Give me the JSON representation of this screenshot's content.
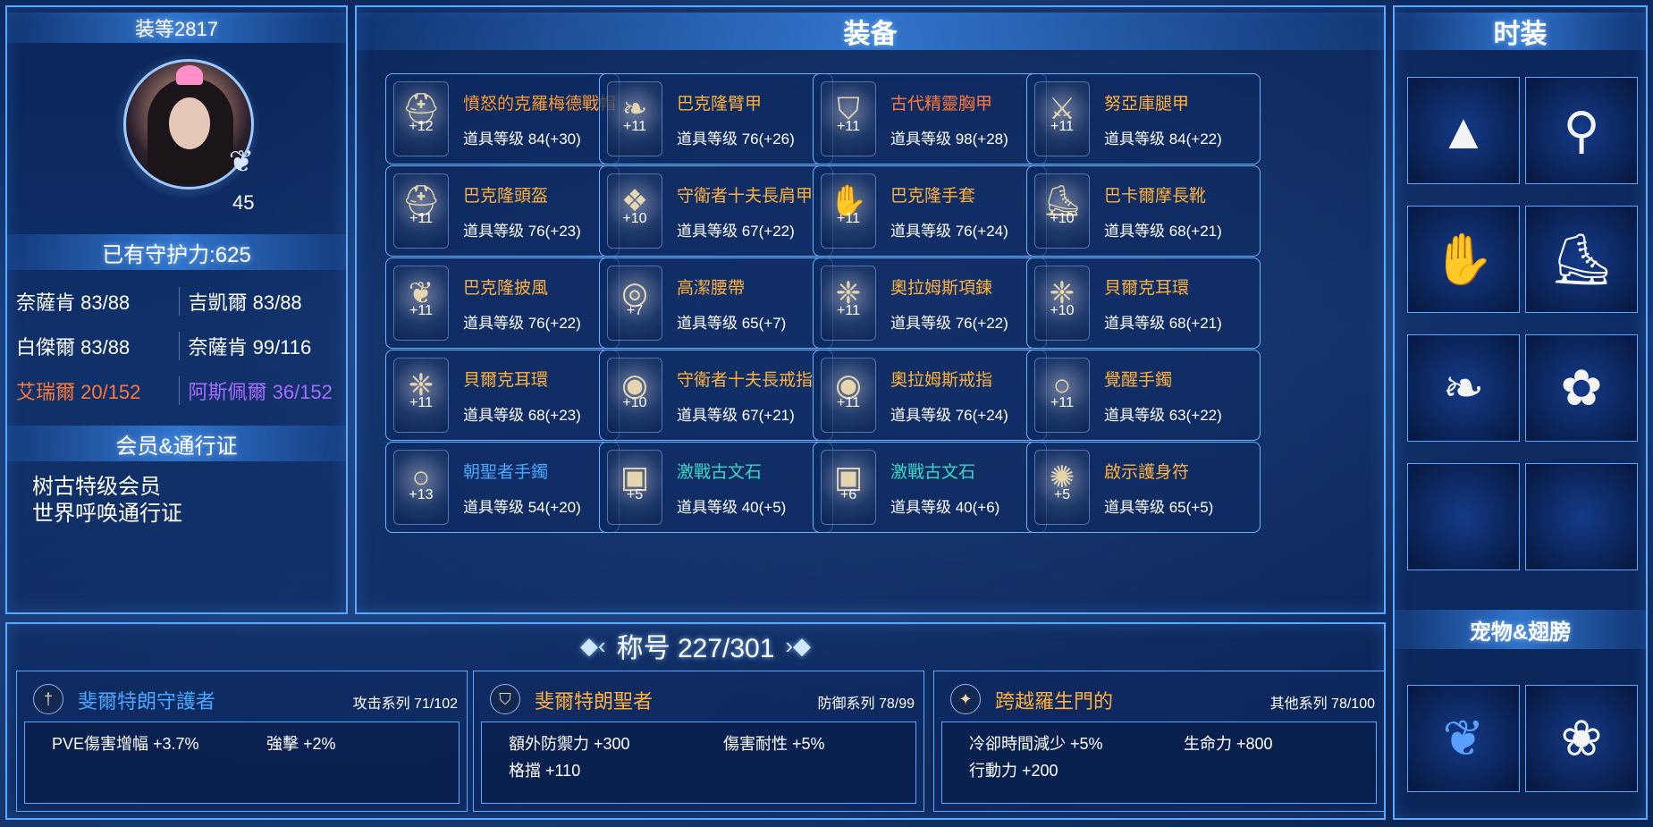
{
  "left": {
    "gear_score": "装等2817",
    "level": "45",
    "guard_power": "已有守护力:625",
    "stats": [
      {
        "text": "奈薩肯 83/88",
        "color": "white"
      },
      {
        "text": "吉凱爾 83/88",
        "color": "white"
      },
      {
        "text": "白傑爾 83/88",
        "color": "white"
      },
      {
        "text": "奈薩肯 99/116",
        "color": "white"
      },
      {
        "text": "艾瑞爾 20/152",
        "color": "orange"
      },
      {
        "text": "阿斯佩爾 36/152",
        "color": "purple"
      }
    ],
    "membership_title": "会员&通行证",
    "memberships": [
      "树古特级会员",
      "世界呼唤通行证"
    ]
  },
  "equipment": {
    "title": "装备",
    "items": [
      {
        "name": "憤怒的克羅梅德戰帽",
        "level": "道具等级 84(+30)",
        "plus": "+12",
        "color": "#ff9a2e",
        "icon": "helmet-icon"
      },
      {
        "name": "巴克隆臂甲",
        "level": "道具等级 76(+26)",
        "plus": "+11",
        "color": "#ffb13c",
        "icon": "bracer-icon"
      },
      {
        "name": "古代精靈胸甲",
        "level": "道具等级 98(+28)",
        "plus": "+11",
        "color": "#ff7a3a",
        "icon": "chest-armor-icon"
      },
      {
        "name": "努亞庫腿甲",
        "level": "道具等级 84(+22)",
        "plus": "+11",
        "color": "#ffb13c",
        "icon": "leg-armor-icon"
      },
      {
        "name": "巴克隆頭盔",
        "level": "道具等级 76(+23)",
        "plus": "+11",
        "color": "#ffb13c",
        "icon": "helm-icon"
      },
      {
        "name": "守衛者十夫長肩甲",
        "level": "道具等级 67(+22)",
        "plus": "+10",
        "color": "#ffb13c",
        "icon": "shoulder-icon"
      },
      {
        "name": "巴克隆手套",
        "level": "道具等级 76(+24)",
        "plus": "+11",
        "color": "#ffb13c",
        "icon": "gloves-icon"
      },
      {
        "name": "巴卡爾摩長靴",
        "level": "道具等级 68(+21)",
        "plus": "+10",
        "color": "#ffb13c",
        "icon": "boots-icon"
      },
      {
        "name": "巴克隆披風",
        "level": "道具等级 76(+22)",
        "plus": "+11",
        "color": "#ffb13c",
        "icon": "cloak-icon"
      },
      {
        "name": "高潔腰帶",
        "level": "道具等级 65(+7)",
        "plus": "+7",
        "color": "#ffb13c",
        "icon": "belt-icon"
      },
      {
        "name": "奧拉姆斯項鍊",
        "level": "道具等级 76(+22)",
        "plus": "+11",
        "color": "#ffb13c",
        "icon": "necklace-icon"
      },
      {
        "name": "貝爾克耳環",
        "level": "道具等级 68(+21)",
        "plus": "+10",
        "color": "#ffb13c",
        "icon": "earring-icon"
      },
      {
        "name": "貝爾克耳環",
        "level": "道具等级 68(+23)",
        "plus": "+11",
        "color": "#ffb13c",
        "icon": "earring-icon"
      },
      {
        "name": "守衛者十夫長戒指",
        "level": "道具等级 67(+21)",
        "plus": "+10",
        "color": "#ffb13c",
        "icon": "ring-icon"
      },
      {
        "name": "奧拉姆斯戒指",
        "level": "道具等级 76(+24)",
        "plus": "+11",
        "color": "#ffb13c",
        "icon": "ring-icon"
      },
      {
        "name": "覺醒手鐲",
        "level": "道具等级 63(+22)",
        "plus": "+11",
        "color": "#ffb13c",
        "icon": "bracelet-icon"
      },
      {
        "name": "朝聖者手鐲",
        "level": "道具等级 54(+20)",
        "plus": "+13",
        "color": "#4aa6ff",
        "icon": "bracelet-icon"
      },
      {
        "name": "激戰古文石",
        "level": "道具等级 40(+5)",
        "plus": "+5",
        "color": "#3ad6c4",
        "icon": "rune-stone-icon"
      },
      {
        "name": "激戰古文石",
        "level": "道具等级 40(+6)",
        "plus": "+6",
        "color": "#3ad6c4",
        "icon": "rune-stone-icon"
      },
      {
        "name": "啟示護身符",
        "level": "道具等级 65(+5)",
        "plus": "+5",
        "color": "#ffb13c",
        "icon": "amulet-icon"
      }
    ]
  },
  "fashion": {
    "title": "时装",
    "slots": [
      "party-hat-icon",
      "pants-icon",
      "glove-icon",
      "boots-icon",
      "wing-ornament-icon",
      "backpack-icon",
      "empty-slot",
      "empty-slot"
    ],
    "pet_title": "宠物&翅膀",
    "pets": [
      "blue-bird-pet-icon",
      "white-wings-icon"
    ]
  },
  "titles": {
    "heading": "称号 227/301",
    "cards": [
      {
        "name": "斐爾特朗守護者",
        "name_color": "#4aa6ff",
        "series": "攻击系列 71/102",
        "icon": "sword-icon",
        "stats": [
          "PVE傷害增幅 +3.7%",
          "強擊 +2%"
        ]
      },
      {
        "name": "斐爾特朗聖者",
        "name_color": "#ffb13c",
        "series": "防御系列 78/99",
        "icon": "shield-icon",
        "stats": [
          "額外防禦力 +300",
          "傷害耐性 +5%",
          "格擋 +110"
        ]
      },
      {
        "name": "跨越羅生門的",
        "name_color": "#ffb13c",
        "series": "其他系列 78/100",
        "icon": "star-icon",
        "stats": [
          "冷卻時間減少 +5%",
          "生命力 +800",
          "行動力 +200"
        ]
      }
    ]
  }
}
